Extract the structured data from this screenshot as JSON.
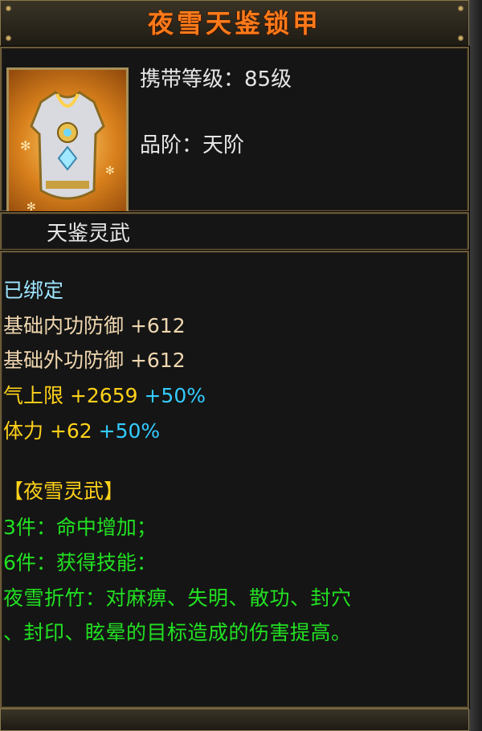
{
  "item": {
    "name": "夜雪天鉴锁甲",
    "level_label": "携带等级：85级",
    "grade_label": "品阶：天阶",
    "icon": "armor-chestplate-icon"
  },
  "section_name": "天鉴灵武",
  "attributes": {
    "bound": "已绑定",
    "inner_def": "基础内功防御 +612",
    "outer_def": "基础外功防御 +612",
    "qi_label": "气上限 +2659",
    "qi_bonus": "+50%",
    "stam_label": "体力 +62",
    "stam_bonus": "+50%"
  },
  "set": {
    "name": "【夜雪灵武】",
    "bonus_3": "3件：命中增加；",
    "bonus_6": "6件：获得技能：",
    "skill_line1": "夜雪折竹：对麻痹、失明、散功、封穴",
    "skill_line2": "、封印、眩晕的目标造成的伤害提高。"
  },
  "colors": {
    "title": "#ff7a1a",
    "bound": "#9ee6ff",
    "base": "#f0d7b0",
    "yellow": "#ffd21a",
    "cyan": "#33ccff",
    "green": "#22e022"
  }
}
